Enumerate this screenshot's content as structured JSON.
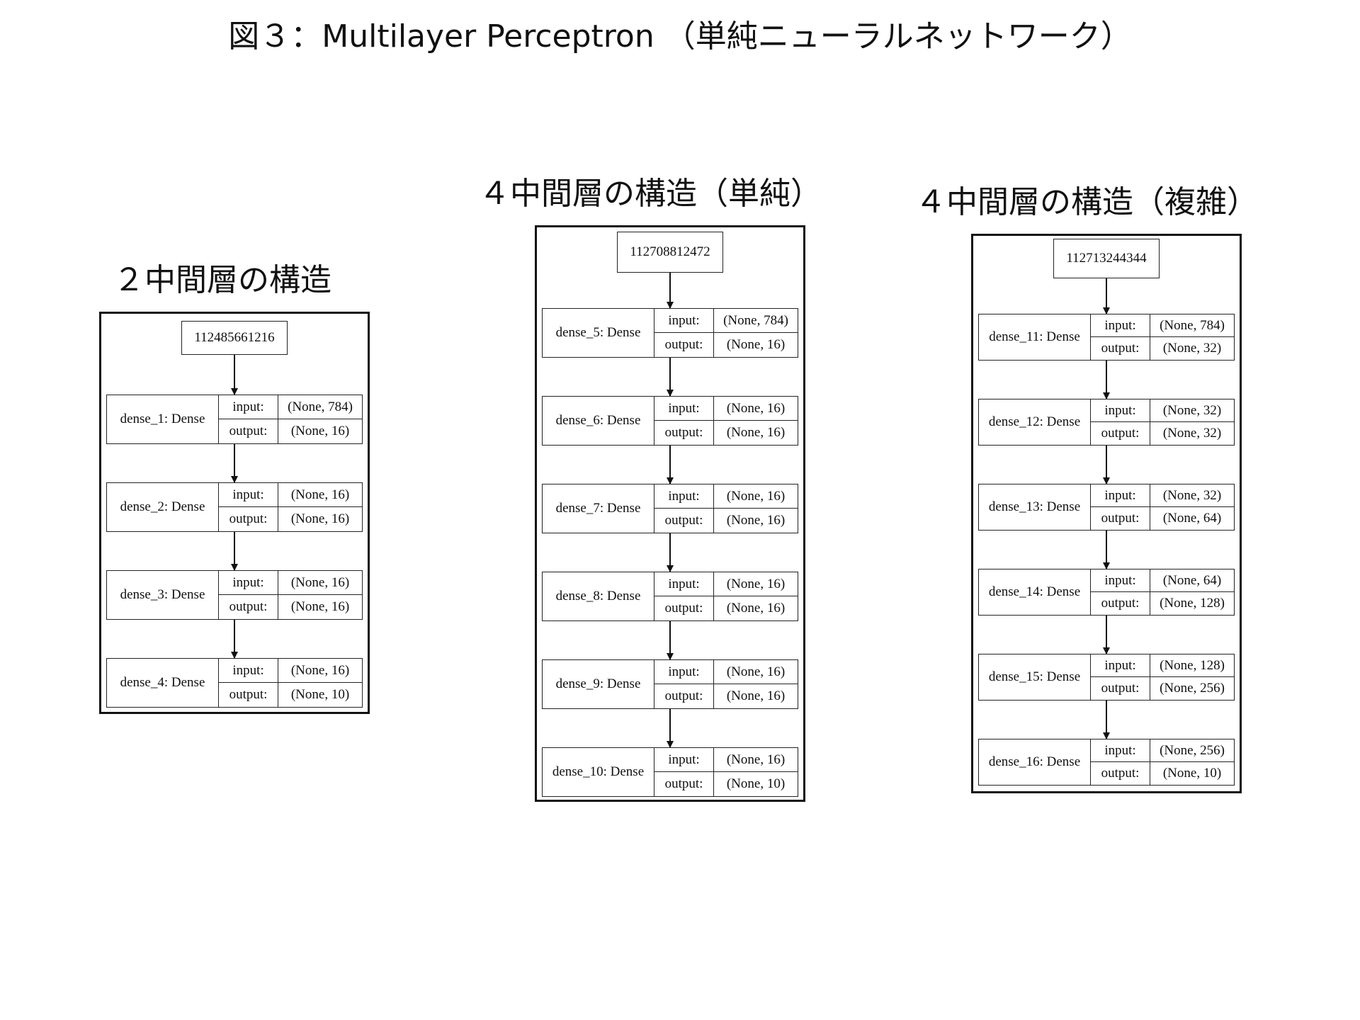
{
  "title": "図３：Multilayer Perceptron （単純ニューラルネットワーク）",
  "input_label": "input:",
  "output_label": "output:",
  "panels": [
    {
      "heading": "２中間層の構造",
      "input_node": "112485661216",
      "layers": [
        {
          "name": "dense_1: Dense",
          "input": "(None, 784)",
          "output": "(None, 16)"
        },
        {
          "name": "dense_2: Dense",
          "input": "(None, 16)",
          "output": "(None, 16)"
        },
        {
          "name": "dense_3: Dense",
          "input": "(None, 16)",
          "output": "(None, 16)"
        },
        {
          "name": "dense_4: Dense",
          "input": "(None, 16)",
          "output": "(None, 10)"
        }
      ]
    },
    {
      "heading": "４中間層の構造（単純）",
      "input_node": "112708812472",
      "layers": [
        {
          "name": "dense_5: Dense",
          "input": "(None, 784)",
          "output": "(None, 16)"
        },
        {
          "name": "dense_6: Dense",
          "input": "(None, 16)",
          "output": "(None, 16)"
        },
        {
          "name": "dense_7: Dense",
          "input": "(None, 16)",
          "output": "(None, 16)"
        },
        {
          "name": "dense_8: Dense",
          "input": "(None, 16)",
          "output": "(None, 16)"
        },
        {
          "name": "dense_9: Dense",
          "input": "(None, 16)",
          "output": "(None, 16)"
        },
        {
          "name": "dense_10: Dense",
          "input": "(None, 16)",
          "output": "(None, 10)"
        }
      ]
    },
    {
      "heading": "４中間層の構造（複雑）",
      "input_node": "112713244344",
      "layers": [
        {
          "name": "dense_11: Dense",
          "input": "(None, 784)",
          "output": "(None, 32)"
        },
        {
          "name": "dense_12: Dense",
          "input": "(None, 32)",
          "output": "(None, 32)"
        },
        {
          "name": "dense_13: Dense",
          "input": "(None, 32)",
          "output": "(None, 64)"
        },
        {
          "name": "dense_14: Dense",
          "input": "(None, 64)",
          "output": "(None, 128)"
        },
        {
          "name": "dense_15: Dense",
          "input": "(None, 128)",
          "output": "(None, 256)"
        },
        {
          "name": "dense_16: Dense",
          "input": "(None, 256)",
          "output": "(None, 10)"
        }
      ]
    }
  ]
}
